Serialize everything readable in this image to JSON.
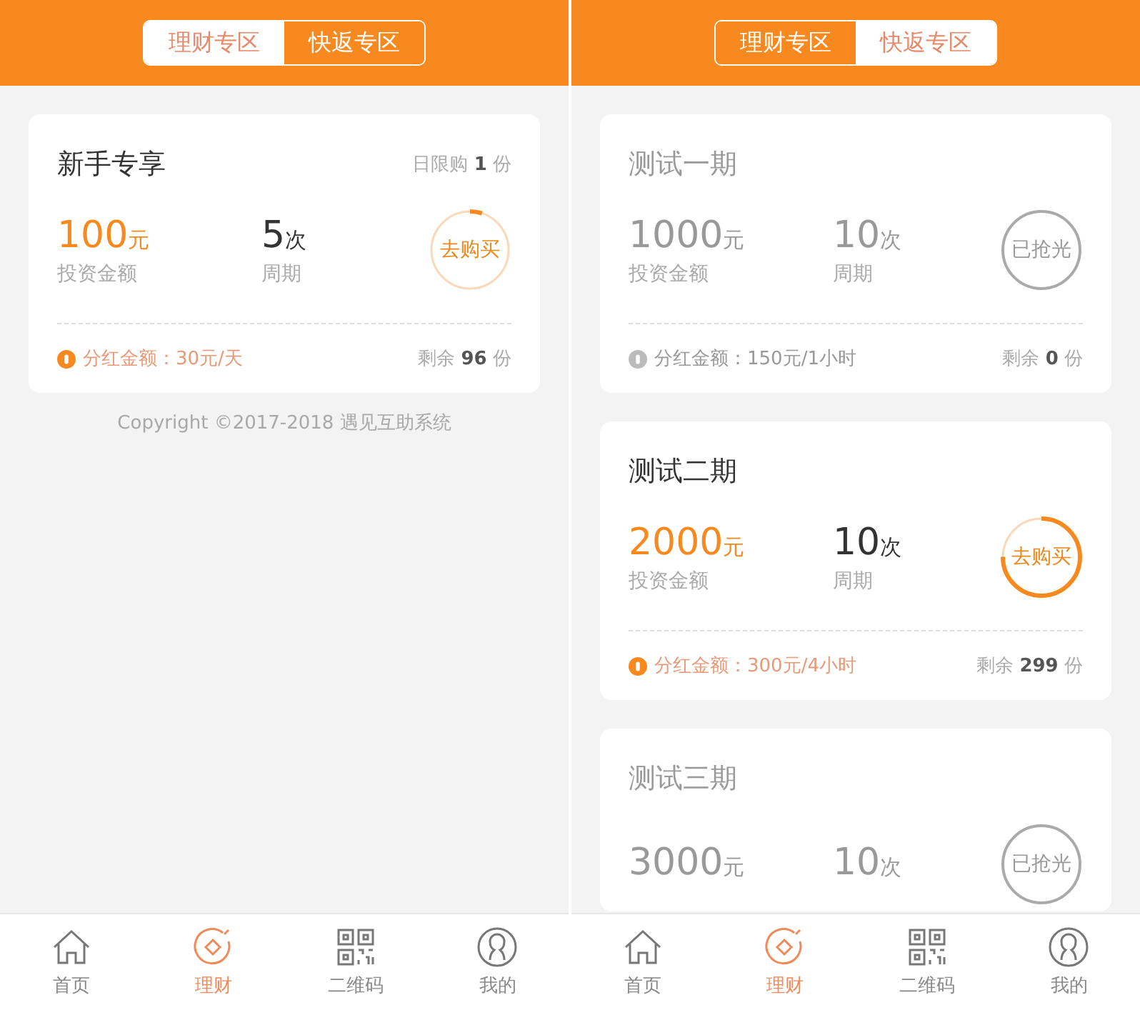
{
  "screens": [
    {
      "segments": [
        {
          "label": "理财专区",
          "selected": false
        },
        {
          "label": "快返专区",
          "selected": true
        }
      ],
      "cards": [
        {
          "title": "新手专享",
          "limit": {
            "prefix": "日限购",
            "count": "1",
            "unit": "份"
          },
          "amount": "100",
          "amount_unit": "元",
          "amount_label": "投资金额",
          "cycle": "5",
          "cycle_unit": "次",
          "cycle_label": "周期",
          "button": "去购买",
          "sold_out": false,
          "level": 0.05,
          "dividend": "分红金额：30元/天",
          "remaining": {
            "prefix": "剩余",
            "count": "96",
            "unit": "份"
          }
        }
      ],
      "copyright": "Copyright ©2017-2018 遇见互助系统",
      "nav": [
        {
          "label": "首页",
          "kind": "home",
          "selected": false
        },
        {
          "label": "理财",
          "kind": "coin",
          "selected": true
        },
        {
          "label": "二维码",
          "kind": "qr",
          "selected": false
        },
        {
          "label": "我的",
          "kind": "user",
          "selected": false
        }
      ]
    },
    {
      "segments": [
        {
          "label": "理财专区",
          "selected": true
        },
        {
          "label": "快返专区",
          "selected": false
        }
      ],
      "cards": [
        {
          "title": "测试一期",
          "amount": "1000",
          "amount_unit": "元",
          "amount_label": "投资金额",
          "cycle": "10",
          "cycle_unit": "次",
          "cycle_label": "周期",
          "button": "已抢光",
          "sold_out": true,
          "dividend": "分红金额：150元/1小时",
          "remaining": {
            "prefix": "剩余",
            "count": "0",
            "unit": "份"
          }
        },
        {
          "title": "测试二期",
          "amount": "2000",
          "amount_unit": "元",
          "amount_label": "投资金额",
          "cycle": "10",
          "cycle_unit": "次",
          "cycle_label": "周期",
          "button": "去购买",
          "sold_out": false,
          "level": 0.75,
          "dividend": "分红金额：300元/4小时",
          "remaining": {
            "prefix": "剩余",
            "count": "299",
            "unit": "份"
          }
        },
        {
          "title": "测试三期",
          "amount": "3000",
          "amount_unit": "元",
          "cycle": "10",
          "cycle_unit": "次",
          "button": "已抢光",
          "sold_out": true
        }
      ],
      "nav": [
        {
          "label": "首页",
          "kind": "home",
          "selected": false
        },
        {
          "label": "理财",
          "kind": "coin",
          "selected": true
        },
        {
          "label": "二维码",
          "kind": "qr",
          "selected": false
        },
        {
          "label": "我的",
          "kind": "user",
          "selected": false
        }
      ]
    }
  ]
}
